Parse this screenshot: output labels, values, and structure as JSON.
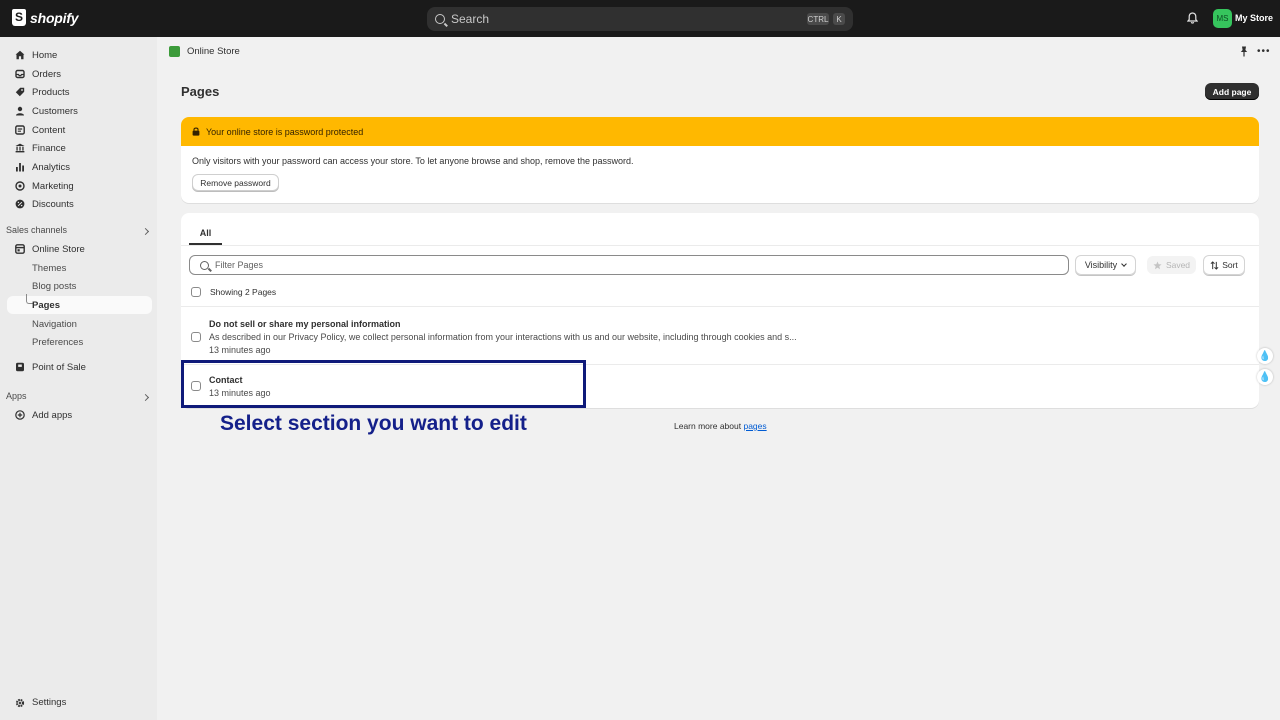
{
  "topbar": {
    "logo_text": "shopify",
    "search_placeholder": "Search",
    "shortcut_ctrl": "CTRL",
    "shortcut_key": "K",
    "avatar_initials": "MS",
    "store_name": "My Store"
  },
  "sidebar": {
    "items": [
      {
        "label": "Home",
        "icon": "home-icon"
      },
      {
        "label": "Orders",
        "icon": "orders-icon"
      },
      {
        "label": "Products",
        "icon": "tag-icon"
      },
      {
        "label": "Customers",
        "icon": "person-icon"
      },
      {
        "label": "Content",
        "icon": "content-icon"
      },
      {
        "label": "Finance",
        "icon": "bank-icon"
      },
      {
        "label": "Analytics",
        "icon": "bar-chart-icon"
      },
      {
        "label": "Marketing",
        "icon": "target-icon"
      },
      {
        "label": "Discounts",
        "icon": "discount-icon"
      }
    ],
    "sales_channels_label": "Sales channels",
    "online_store_label": "Online Store",
    "online_store_sub": [
      "Themes",
      "Blog posts",
      "Pages",
      "Navigation",
      "Preferences"
    ],
    "active_sub": "Pages",
    "point_of_sale_label": "Point of Sale",
    "apps_label": "Apps",
    "add_apps_label": "Add apps",
    "settings_label": "Settings"
  },
  "breadcrumb": {
    "label": "Online Store"
  },
  "page": {
    "title": "Pages",
    "add_button": "Add page"
  },
  "banner": {
    "title": "Your online store is password protected",
    "text": "Only visitors with your password can access your store. To let anyone browse and shop, remove the password.",
    "button": "Remove password",
    "color": "#ffb800"
  },
  "list": {
    "tab_all": "All",
    "filter_placeholder": "Filter Pages",
    "visibility_label": "Visibility",
    "saved_label": "Saved",
    "sort_label": "Sort",
    "showing_text": "Showing 2 Pages",
    "rows": [
      {
        "title": "Do not sell or share my personal information",
        "description": "As described in our Privacy Policy, we collect personal information from your interactions with us and our website, including through cookies and s...",
        "time": "13 minutes ago"
      },
      {
        "title": "Contact",
        "description": "",
        "time": "13 minutes ago"
      }
    ]
  },
  "footer": {
    "learn_prefix": "Learn more about ",
    "learn_link": "pages"
  },
  "annotation": {
    "instruction": "Select section you want to edit",
    "color": "#14208a"
  }
}
